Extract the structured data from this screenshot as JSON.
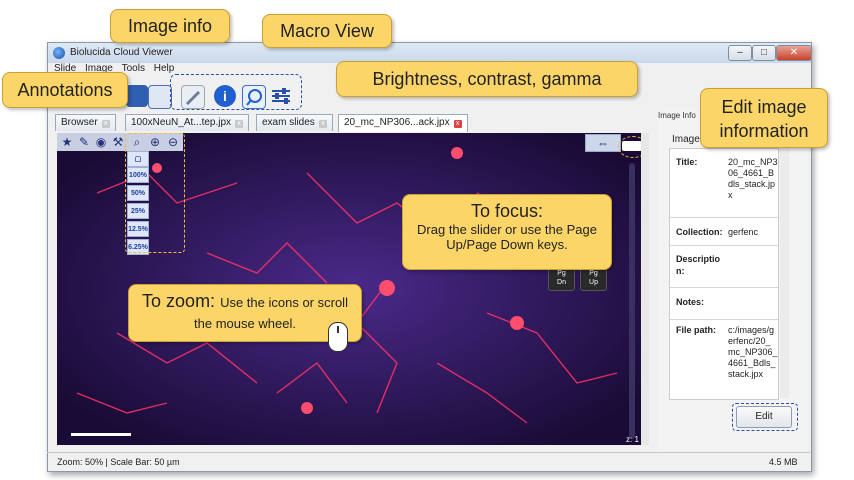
{
  "window": {
    "title": "Biolucida Cloud Viewer",
    "controls": [
      "–",
      "□",
      "✕"
    ]
  },
  "menu": [
    "Slide",
    "Image",
    "Tools",
    "Help"
  ],
  "tabs": [
    {
      "label": "Browser",
      "active": false
    },
    {
      "label": "100xNeuN_At...tep.jpx",
      "active": false
    },
    {
      "label": "exam slides",
      "active": false
    },
    {
      "label": "20_mc_NP306...ack.jpx",
      "active": true
    }
  ],
  "zoom_levels": [
    "100%",
    "50%",
    "25%",
    "12.5%",
    "6.25%"
  ],
  "viewer": {
    "z_readout": "z: 1"
  },
  "keys": {
    "pgdn": "Pg\nDn",
    "pgup": "Pg\nUp"
  },
  "panel": {
    "tab": "Image Info",
    "header": "Image",
    "fields": [
      {
        "label": "Title:",
        "value": "20_mc_NP306_4661_Bdls_stack.jpx"
      },
      {
        "label": "Collection:",
        "value": "gerfenc"
      },
      {
        "label": "Description:",
        "value": ""
      },
      {
        "label": "Notes:",
        "value": ""
      },
      {
        "label": "File path:",
        "value": "c:/images/gerfenc/20_mc_NP306_4661_Bdls_stack.jpx"
      }
    ],
    "edit_label": "Edit"
  },
  "status": {
    "left": "Zoom: 50% | Scale Bar: 50 µm",
    "right": "4.5 MB"
  },
  "callouts": {
    "image_info": "Image  info",
    "macro_view": "Macro View",
    "annotations": "Annotations",
    "brightness": "Brightness, contrast, gamma",
    "edit_image": "Edit image information",
    "focus_title": "To focus:",
    "focus_body": "Drag the slider or use the Page Up/Page Down keys.",
    "zoom_title": "To zoom:",
    "zoom_body": "Use the icons or scroll the mouse wheel."
  },
  "colors": {
    "callout": "#fbd568",
    "accent": "#2a4fa8",
    "tab_close": "#e04343",
    "image_bg": "#1d0f3c",
    "neuron": "#ff3355"
  },
  "icons": [
    "app-icon",
    "star-icon",
    "annotation-pen-icon",
    "eye-icon",
    "wrench-icon",
    "zoom-icon",
    "zoom-in-icon",
    "zoom-out-icon",
    "info-icon",
    "macro-view-icon",
    "sliders-icon",
    "mouse-icon"
  ]
}
